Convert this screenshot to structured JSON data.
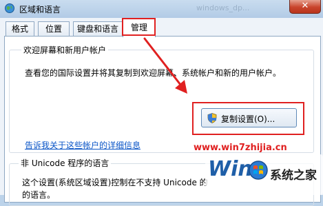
{
  "window": {
    "title": "区域和语言",
    "ghost_title": "windows_dp..."
  },
  "tabs": [
    {
      "label": "格式"
    },
    {
      "label": "位置"
    },
    {
      "label": "键盘和语言"
    },
    {
      "label": "管理",
      "active": true
    }
  ],
  "welcome_group": {
    "label": "欢迎屏幕和新用户帐户",
    "description": "查看您的国际设置并将其复制到欢迎屏幕、系统帐户和新的用户帐户。",
    "copy_button": "复制设置(O)...",
    "link": "告诉我关于这些帐户的详细信息"
  },
  "unicode_group": {
    "label": "非 Unicode 程序的语言",
    "line1": "这个设置(系统区域设置)控制在不支持 Unicode 的",
    "line2": "的语言。"
  },
  "watermark": {
    "url": "www.win7zhijia.cn",
    "logo_text": "Win",
    "home_text": "系统之家"
  },
  "colors": {
    "highlight": "#e02020",
    "link": "#0a55c7"
  }
}
